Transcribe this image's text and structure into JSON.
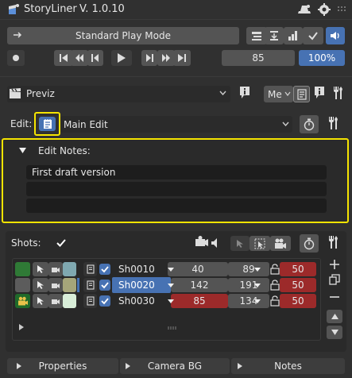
{
  "header": {
    "title": "StoryLiner",
    "version": "V. 1.0.10"
  },
  "play": {
    "mode": "Standard Play Mode",
    "frame": "85",
    "speed": "100%"
  },
  "take": {
    "name": "Previz",
    "me_label": "Me"
  },
  "edit": {
    "label": "Edit:",
    "name": "Main Edit"
  },
  "notes": {
    "title": "Edit Notes:",
    "lines": [
      "First draft version",
      "",
      ""
    ]
  },
  "shots": {
    "label": "Shots:",
    "rows": [
      {
        "name": "Sh0010",
        "start": "40",
        "end": "89",
        "duration": "50",
        "color": "#2f7a36",
        "selected": false,
        "start_warn": false
      },
      {
        "name": "Sh0020",
        "start": "142",
        "end": "191",
        "duration": "50",
        "color": "#5c5c5c",
        "selected": true,
        "start_warn": false
      },
      {
        "name": "Sh0030",
        "start": "85",
        "end": "134",
        "duration": "50",
        "color": "#1f6a2a",
        "selected": false,
        "start_warn": true
      }
    ]
  },
  "bottom_tabs": [
    "Properties",
    "Camera BG",
    "Notes"
  ],
  "colors": {
    "highlight": "#f5e400",
    "accent": "#4772b3",
    "warn": "#9c2a2a"
  }
}
